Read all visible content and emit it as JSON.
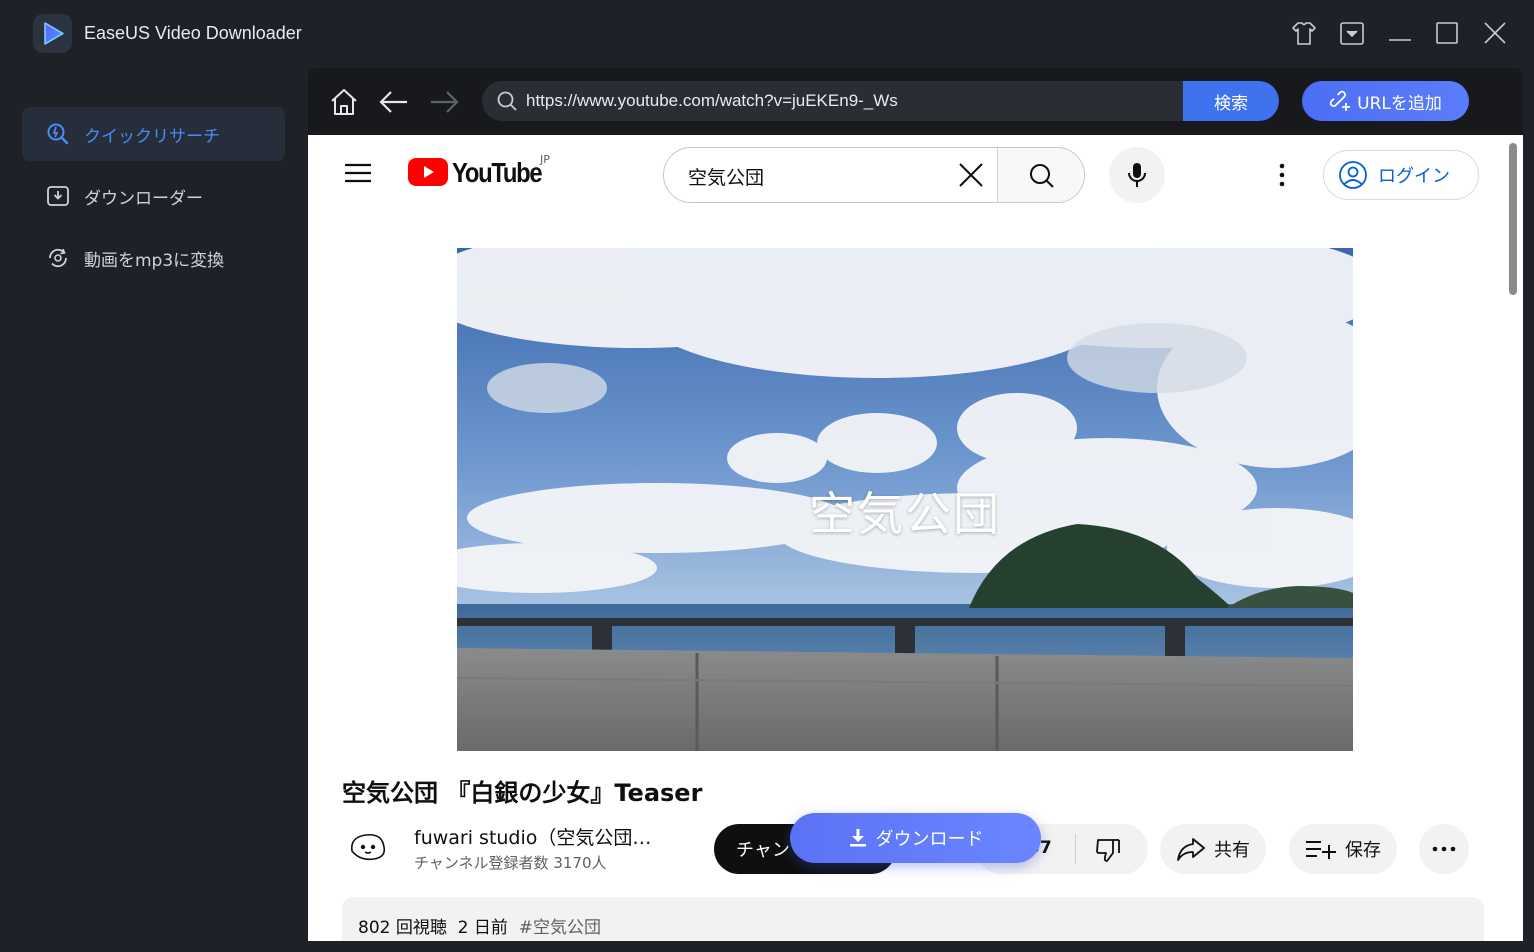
{
  "app": {
    "title": "EaseUS Video Downloader"
  },
  "sidebar": {
    "items": [
      {
        "label": "クイックリサーチ",
        "icon": "quick-search-icon",
        "active": true
      },
      {
        "label": "ダウンローダー",
        "icon": "downloader-icon",
        "active": false
      },
      {
        "label": "動画をmp3に変換",
        "icon": "convert-icon",
        "active": false
      }
    ]
  },
  "browser": {
    "url": "https://www.youtube.com/watch?v=juEKEn9-_Ws",
    "search_label": "検索",
    "add_url_label": "URLを追加"
  },
  "youtube": {
    "logo_text": "YouTube",
    "region": "JP",
    "search_query": "空気公団",
    "login_label": "ログイン",
    "video_caption": "空気公団",
    "video_title": "空気公団 『白銀の少女』Teaser",
    "channel_name": "fuwari studio（空気公団…",
    "subscribers": "チャンネル登録者数 3170人",
    "subscribe_label": "チャン",
    "like_count": "57",
    "share_label": "共有",
    "save_label": "保存",
    "views": "802 回視聴",
    "age": "2 日前",
    "hashtag": "#空気公団"
  },
  "overlay": {
    "download_label": "ダウンロード"
  },
  "colors": {
    "accent": "#3f72ee",
    "sidebar_active_text": "#4a8cf7",
    "youtube_red": "#ff0000"
  }
}
